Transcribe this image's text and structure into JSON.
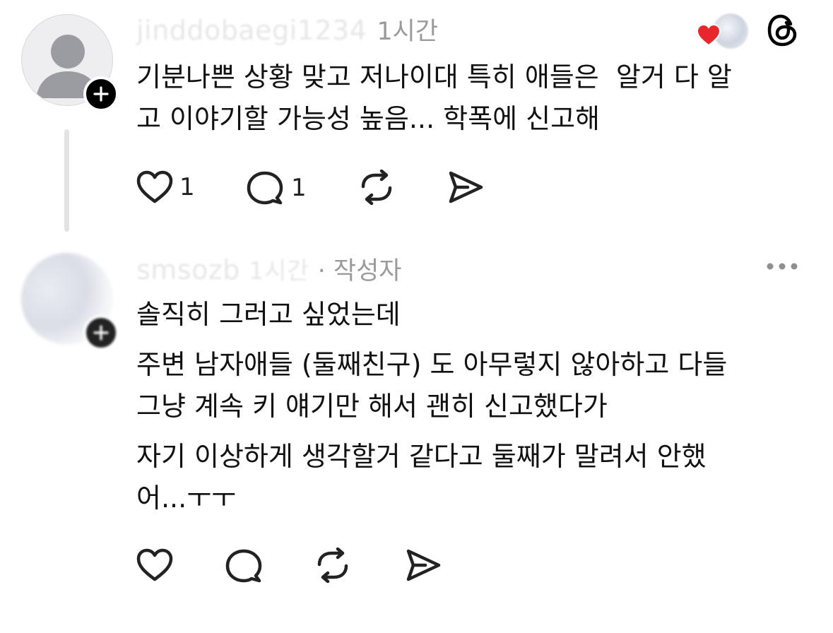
{
  "comment1": {
    "username": "jinddobaegi1234",
    "time": "1시간",
    "body": "기분나쁜 상황 맞고 저나이대 특히 애들은  알거 다 알\n고 이야기할 가능성 높음... 학폭에 신고해",
    "likes": "1",
    "replies": "1"
  },
  "comment2": {
    "username": "smsozb",
    "time": "1시간",
    "author_tag": "· 작성자",
    "paragraphs": [
      "솔직히 그러고 싶었는데",
      "주변 남자애들 (둘째친구) 도 아무렇지 않아하고 다들\n그냥 계속 키 얘기만 해서 괜히 신고했다가",
      "자기 이상하게 생각할거 같다고 둘째가 말려서 안했\n어...ㅜㅜ"
    ]
  },
  "colors": {
    "heart": "#e8262e",
    "meta": "#9a9a9f",
    "line": "#e3e3e6"
  },
  "icons": [
    "follow-plus-icon",
    "heart-icon",
    "comment-icon",
    "repost-icon",
    "share-icon",
    "threads-logo-icon",
    "more-icon"
  ]
}
